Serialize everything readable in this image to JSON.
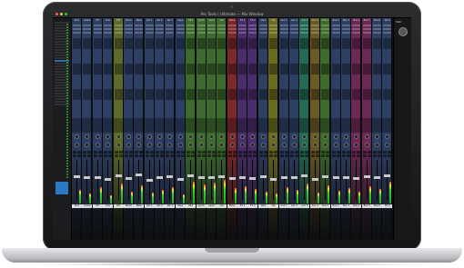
{
  "window": {
    "title": "Pro Tools | Ultimate — Mix Window",
    "traffic_lights": [
      "#ff5f57",
      "#febc2e",
      "#28c840"
    ]
  },
  "right_panel": {
    "label": "Mstr"
  },
  "strips": [
    {
      "name": "Kick",
      "color": "#2d3f63",
      "fader": 0.62,
      "meter": 0.35
    },
    {
      "name": "Snare",
      "color": "#2d3f63",
      "fader": 0.58,
      "meter": 0.25
    },
    {
      "name": "HH",
      "color": "#2d3f63",
      "fader": 0.6,
      "meter": 0.4
    },
    {
      "name": "Tom",
      "color": "#2d3f63",
      "fader": 0.55,
      "meter": 0.2
    },
    {
      "name": "OH",
      "color": "#5c6b2a",
      "fader": 0.64,
      "meter": 0.5
    },
    {
      "name": "Room",
      "color": "#2d3f63",
      "fader": 0.57,
      "meter": 0.3
    },
    {
      "name": "Bass",
      "color": "#2d3f63",
      "fader": 0.66,
      "meter": 0.45
    },
    {
      "name": "Gtr 1",
      "color": "#2d3f63",
      "fader": 0.52,
      "meter": 0.28
    },
    {
      "name": "Gtr 2",
      "color": "#2d3f63",
      "fader": 0.59,
      "meter": 0.33
    },
    {
      "name": "Gtr 3",
      "color": "#2d3f63",
      "fader": 0.61,
      "meter": 0.42
    },
    {
      "name": "Keys",
      "color": "#2d3f63",
      "fader": 0.55,
      "meter": 0.22
    },
    {
      "name": "Pad",
      "color": "#3d6b2d",
      "fader": 0.63,
      "meter": 0.55
    },
    {
      "name": "Synth",
      "color": "#3d6b2d",
      "fader": 0.6,
      "meter": 0.48
    },
    {
      "name": "Lead",
      "color": "#3d6b2d",
      "fader": 0.58,
      "meter": 0.52
    },
    {
      "name": "Vox",
      "color": "#3d6b2d",
      "fader": 0.62,
      "meter": 0.6
    },
    {
      "name": "BVox",
      "color": "#7a2a2a",
      "fader": 0.56,
      "meter": 0.38
    },
    {
      "name": "FX 1",
      "color": "#4a2e6b",
      "fader": 0.6,
      "meter": 0.44
    },
    {
      "name": "FX 2",
      "color": "#4a2e6b",
      "fader": 0.57,
      "meter": 0.36
    },
    {
      "name": "Verb",
      "color": "#2d3f63",
      "fader": 0.61,
      "meter": 0.3
    },
    {
      "name": "Dly",
      "color": "#6b6b22",
      "fader": 0.54,
      "meter": 0.26
    },
    {
      "name": "Aux 1",
      "color": "#2d3f63",
      "fader": 0.6,
      "meter": 0.4
    },
    {
      "name": "Aux 2",
      "color": "#2d3f63",
      "fader": 0.59,
      "meter": 0.34
    },
    {
      "name": "Aux 3",
      "color": "#236b55",
      "fader": 0.63,
      "meter": 0.5
    },
    {
      "name": "Aux 4",
      "color": "#6b5a22",
      "fader": 0.55,
      "meter": 0.27
    },
    {
      "name": "Bus 1",
      "color": "#3d6b2d",
      "fader": 0.62,
      "meter": 0.46
    },
    {
      "name": "Bus 2",
      "color": "#2d3f63",
      "fader": 0.58,
      "meter": 0.31
    },
    {
      "name": "Bus 3",
      "color": "#2d3f63",
      "fader": 0.6,
      "meter": 0.39
    },
    {
      "name": "Bus 4",
      "color": "#6b2a55",
      "fader": 0.57,
      "meter": 0.29
    },
    {
      "name": "Bus 5",
      "color": "#6b2a55",
      "fader": 0.61,
      "meter": 0.43
    },
    {
      "name": "Bus 6",
      "color": "#2d3f63",
      "fader": 0.59,
      "meter": 0.37
    },
    {
      "name": "Print",
      "color": "#2d3f63",
      "fader": 0.64,
      "meter": 0.55
    }
  ]
}
